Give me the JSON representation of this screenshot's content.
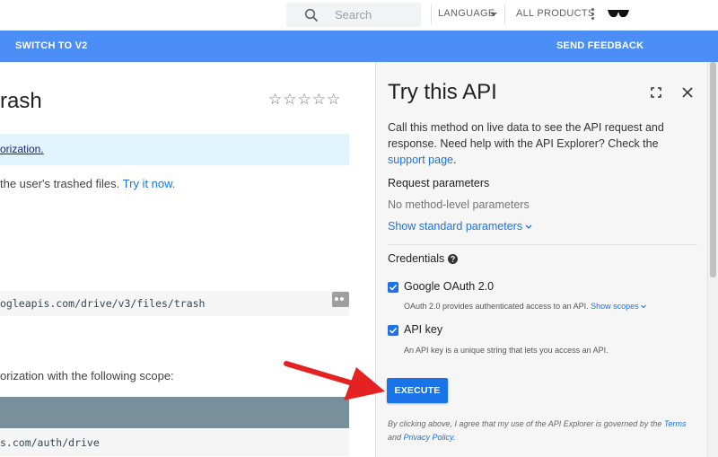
{
  "header": {
    "search_placeholder": "Search",
    "language_label": "LANGUAGE",
    "all_products_label": "ALL PRODUCTS"
  },
  "bluebar": {
    "switch_label": "SWITCH TO V2",
    "feedback_label": "SEND FEEDBACK"
  },
  "doc": {
    "title_fragment": "rash",
    "note_fragment": "orization.",
    "desc_text": " the user's trashed files. ",
    "try_link": "Try it now.",
    "endpoint_fragment": "ogleapis.com/drive/v3/files/trash",
    "scope_text": "orization with the following scope:",
    "scope_url_fragment": "s.com/auth/drive"
  },
  "panel": {
    "title": "Try this API",
    "description": "Call this method on live data to see the API request and response. Need help with the API Explorer? Check the ",
    "support_link": "support page",
    "desc_end": ".",
    "request_params_heading": "Request parameters",
    "no_params_text": "No method-level parameters",
    "show_std_params": "Show standard parameters",
    "credentials_heading": "Credentials",
    "oauth_label": "Google OAuth 2.0",
    "oauth_desc": "OAuth 2.0 provides authenticated access to an API. ",
    "show_scopes": "Show scopes",
    "api_key_label": "API key",
    "api_key_desc": "An API key is a unique string that lets you access an API.",
    "execute_label": "EXECUTE",
    "legal_text": "By clicking above, I agree that my use of the API Explorer is governed by the ",
    "terms_link": "Terms",
    "and_text": " and ",
    "privacy_link": "Privacy Policy",
    "legal_end": "."
  },
  "colors": {
    "accent_blue": "#4b8ef5",
    "button_blue": "#1a73e8",
    "arrow_red": "#e52222"
  }
}
